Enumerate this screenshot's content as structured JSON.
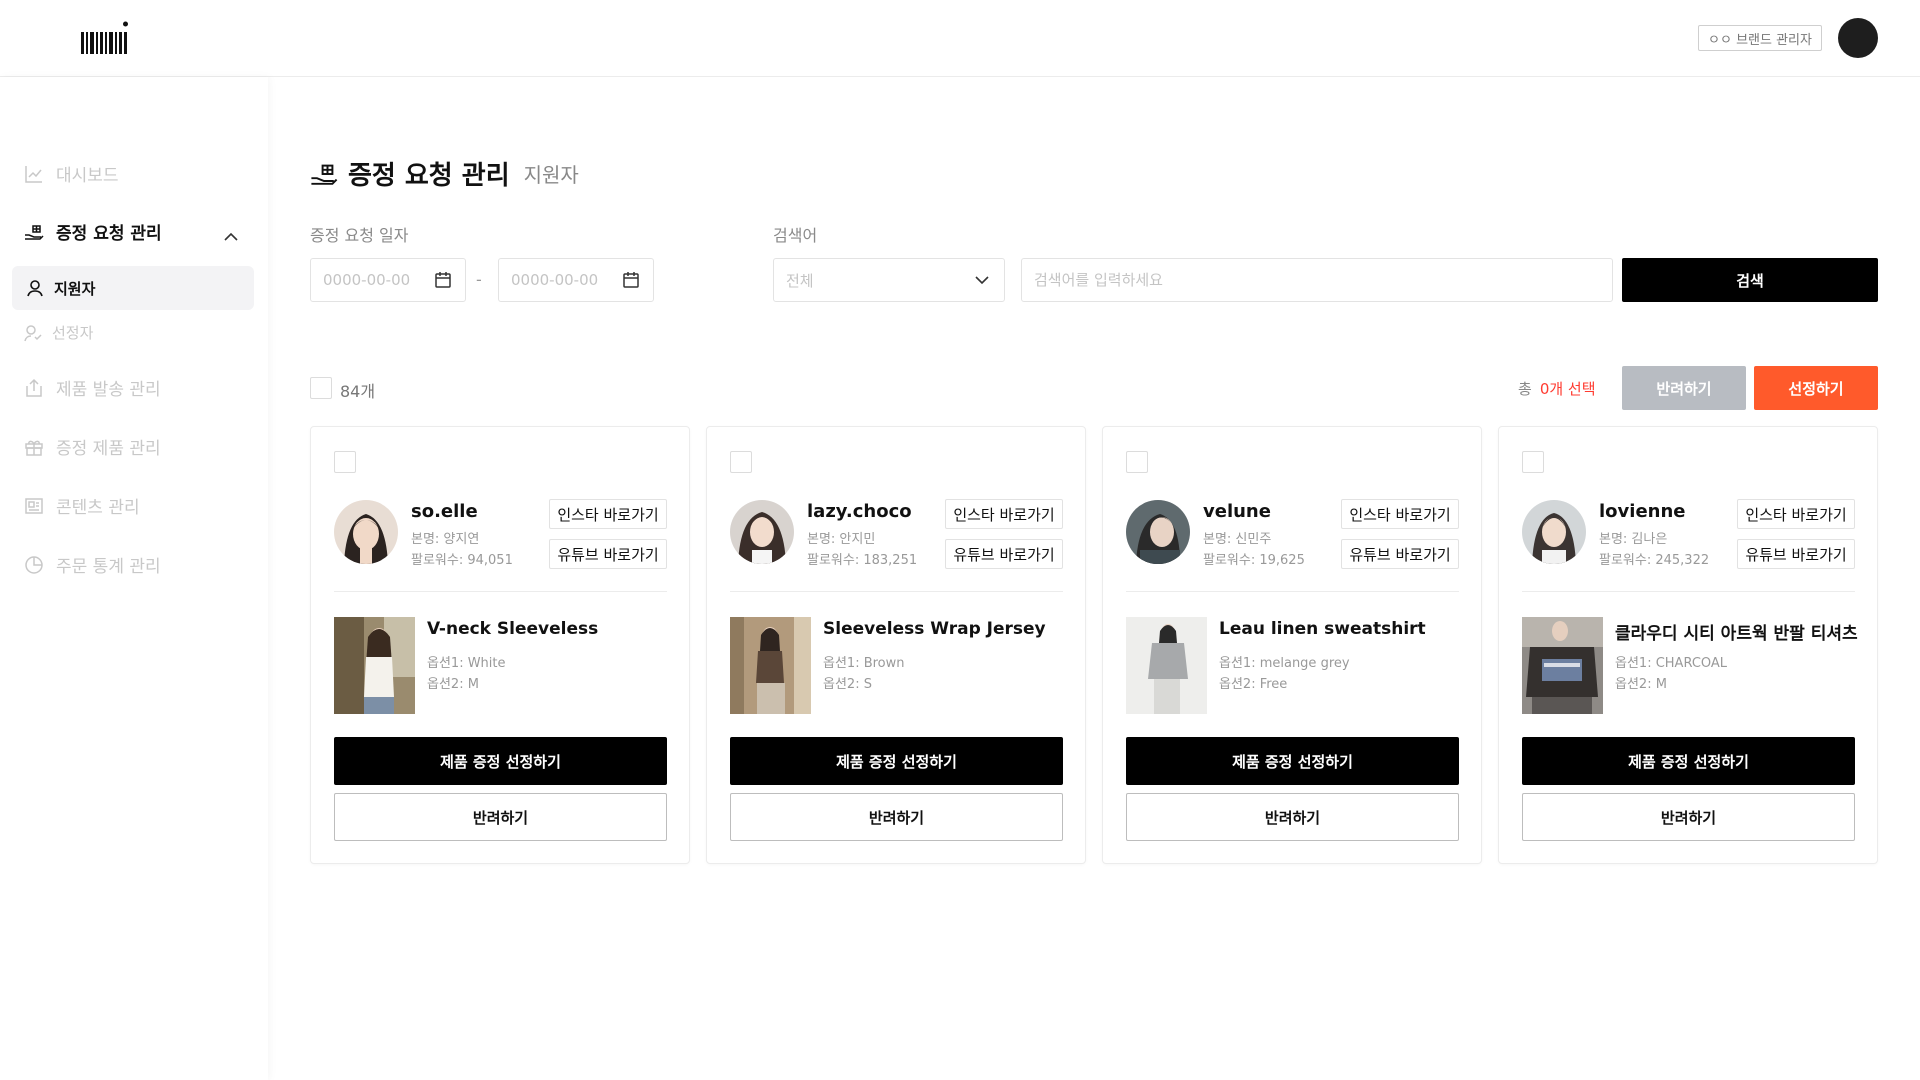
{
  "header": {
    "brand_badge": "ㅇㅇ 브랜드 관리자"
  },
  "sidebar": {
    "items": [
      {
        "label": "대시보드",
        "icon": "chart-line-icon"
      },
      {
        "label": "증정 요청 관리",
        "icon": "gift-hand-icon"
      },
      {
        "label": "제품 발송 관리",
        "icon": "box-upload-icon"
      },
      {
        "label": "증정 제품 관리",
        "icon": "gift-box-icon"
      },
      {
        "label": "콘텐츠 관리",
        "icon": "content-icon"
      },
      {
        "label": "주문 통계 관리",
        "icon": "stats-icon"
      }
    ],
    "sub_items": [
      {
        "label": "지원자",
        "icon": "user-icon"
      },
      {
        "label": "선정자",
        "icon": "user-check-icon"
      }
    ]
  },
  "main": {
    "title": "증정 요청 관리",
    "subtitle": "지원자",
    "filters": {
      "date_label": "증정 요청 일자",
      "date_start_placeholder": "0000-00-00",
      "date_end_placeholder": "0000-00-00",
      "date_separator": "-",
      "search_label": "검색어",
      "select_value": "전체",
      "search_placeholder": "검색어를 입력하세요",
      "search_button": "검색"
    },
    "toolbar": {
      "count": "84개",
      "total_prefix": "총",
      "selected_count": "0개 선택",
      "reject_button": "반려하기",
      "select_button": "선정하기"
    },
    "cards": [
      {
        "handle": "so.elle",
        "name": "본명: 양지연",
        "followers": "팔로워수: 94,051",
        "insta_button": "인스타 바로가기",
        "youtube_button": "유튜브 바로가기",
        "product_name": "V-neck Sleeveless",
        "option1": "옵션1: White",
        "option2": "옵션2: M",
        "gift_button": "제품 증정 선정하기",
        "reject_button": "반려하기"
      },
      {
        "handle": "lazy.choco",
        "name": "본명: 안지민",
        "followers": "팔로워수: 183,251",
        "insta_button": "인스타 바로가기",
        "youtube_button": "유튜브 바로가기",
        "product_name": "Sleeveless Wrap Jersey",
        "option1": "옵션1: Brown",
        "option2": "옵션2: S",
        "gift_button": "제품 증정 선정하기",
        "reject_button": "반려하기"
      },
      {
        "handle": "velune",
        "name": "본명: 신민주",
        "followers": "팔로워수: 19,625",
        "insta_button": "인스타 바로가기",
        "youtube_button": "유튜브 바로가기",
        "product_name": "Leau linen sweatshirt",
        "option1": "옵션1: melange grey",
        "option2": "옵션2: Free",
        "gift_button": "제품 증정 선정하기",
        "reject_button": "반려하기"
      },
      {
        "handle": "lovienne",
        "name": "본명: 김나은",
        "followers": "팔로워수: 245,322",
        "insta_button": "인스타 바로가기",
        "youtube_button": "유튜브 바로가기",
        "product_name": "클라우디 시티 아트웍 반팔 티셔츠",
        "option1": "옵션1: CHARCOAL",
        "option2": "옵션2: M",
        "gift_button": "제품 증정 선정하기",
        "reject_button": "반려하기"
      }
    ]
  },
  "colors": {
    "accent": "#ff5a2b",
    "primary": "#000000",
    "disabled": "#b8bcc2",
    "highlight": "#ff3b30"
  }
}
